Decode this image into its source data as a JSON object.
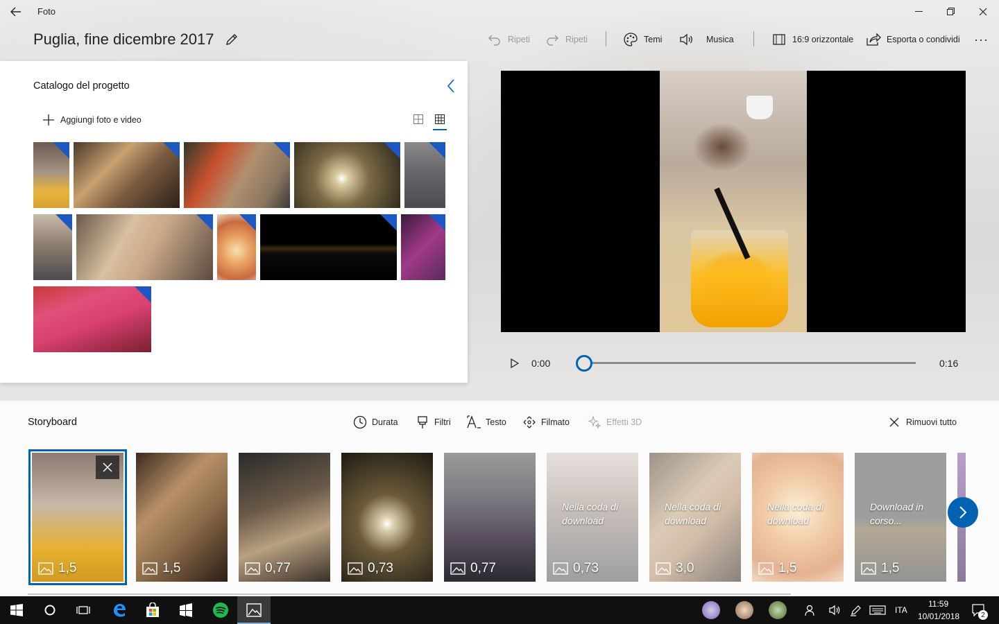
{
  "window": {
    "app_name": "Foto",
    "project_title": "Puglia, fine dicembre 2017"
  },
  "toolbar": {
    "undo_label": "Ripeti",
    "redo_label": "Ripeti",
    "themes_label": "Temi",
    "music_label": "Musica",
    "aspect_label": "16:9 orizzontale",
    "export_label": "Esporta o condividi"
  },
  "catalog": {
    "title": "Catalogo del progetto",
    "add_label": "Aggiungi foto e video"
  },
  "player": {
    "current_time": "0:00",
    "total_time": "0:16",
    "progress": 0
  },
  "storyboard": {
    "title": "Storyboard",
    "tools": {
      "duration": "Durata",
      "filters": "Filtri",
      "text": "Testo",
      "motion": "Filmato",
      "effects3d": "Effetti 3D",
      "remove_all": "Rimuovi tutto"
    },
    "clips": [
      {
        "duration": "1,5",
        "status": "",
        "selected": true
      },
      {
        "duration": "1,5",
        "status": ""
      },
      {
        "duration": "0,77",
        "status": ""
      },
      {
        "duration": "0,73",
        "status": ""
      },
      {
        "duration": "0,77",
        "status": ""
      },
      {
        "duration": "0,73",
        "status": "Nella coda di download"
      },
      {
        "duration": "3,0",
        "status": "Nella coda di download"
      },
      {
        "duration": "1,5",
        "status": "Nella coda di download"
      },
      {
        "duration": "1,5",
        "status": "Download in corso..."
      }
    ]
  },
  "taskbar": {
    "language": "ITA",
    "time": "11:59",
    "date": "10/01/2018",
    "notification_count": "2"
  },
  "colors": {
    "accent": "#0063b1",
    "corner_badge": "#1c58c4",
    "taskbar": "#101010"
  }
}
